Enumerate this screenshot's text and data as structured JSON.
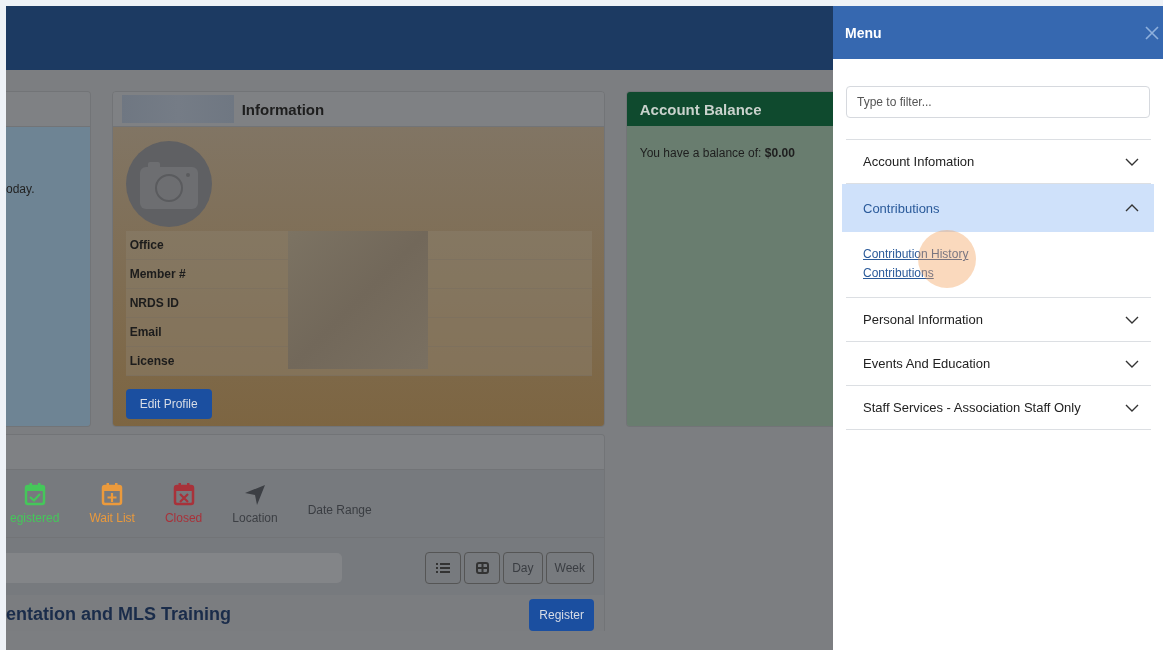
{
  "welcome_card": {
    "text": "oday."
  },
  "info_card": {
    "title": "Information",
    "fields": [
      {
        "label": "Office"
      },
      {
        "label": "Member #"
      },
      {
        "label": "NRDS ID"
      },
      {
        "label": "Email"
      },
      {
        "label": "License"
      }
    ],
    "button": "Edit Profile"
  },
  "balance_card": {
    "title": "Account Balance",
    "text": "You have a balance of: **$0.00**"
  },
  "events": {
    "legend": [
      {
        "kind": "registered",
        "label": "egistered",
        "color": "#45c75a"
      },
      {
        "kind": "waitlist",
        "label": "Wait List",
        "color": "#eb9a3c"
      },
      {
        "kind": "closed",
        "label": "Closed",
        "color": "#a8323a"
      },
      {
        "kind": "location",
        "label": "Location",
        "color": "#3c3f44"
      }
    ],
    "date_range": "Date Range",
    "views": [
      {
        "kind": "list"
      },
      {
        "kind": "grid"
      },
      {
        "kind": "text",
        "label": "Day"
      },
      {
        "kind": "text",
        "label": "Week"
      }
    ],
    "event_title": "entation and MLS Training",
    "register": "Register"
  },
  "menu": {
    "title": "Menu",
    "filter_placeholder": "Type to filter...",
    "sections": [
      {
        "label": "Account Infomation",
        "expanded": false
      },
      {
        "label": "Contributions",
        "expanded": true,
        "children": [
          {
            "label": "Contribution History"
          },
          {
            "label": "Contributions"
          }
        ]
      },
      {
        "label": "Personal Information",
        "expanded": false
      },
      {
        "label": "Events And Education",
        "expanded": false
      },
      {
        "label": "Staff Services - Association Staff Only",
        "expanded": false
      }
    ]
  }
}
